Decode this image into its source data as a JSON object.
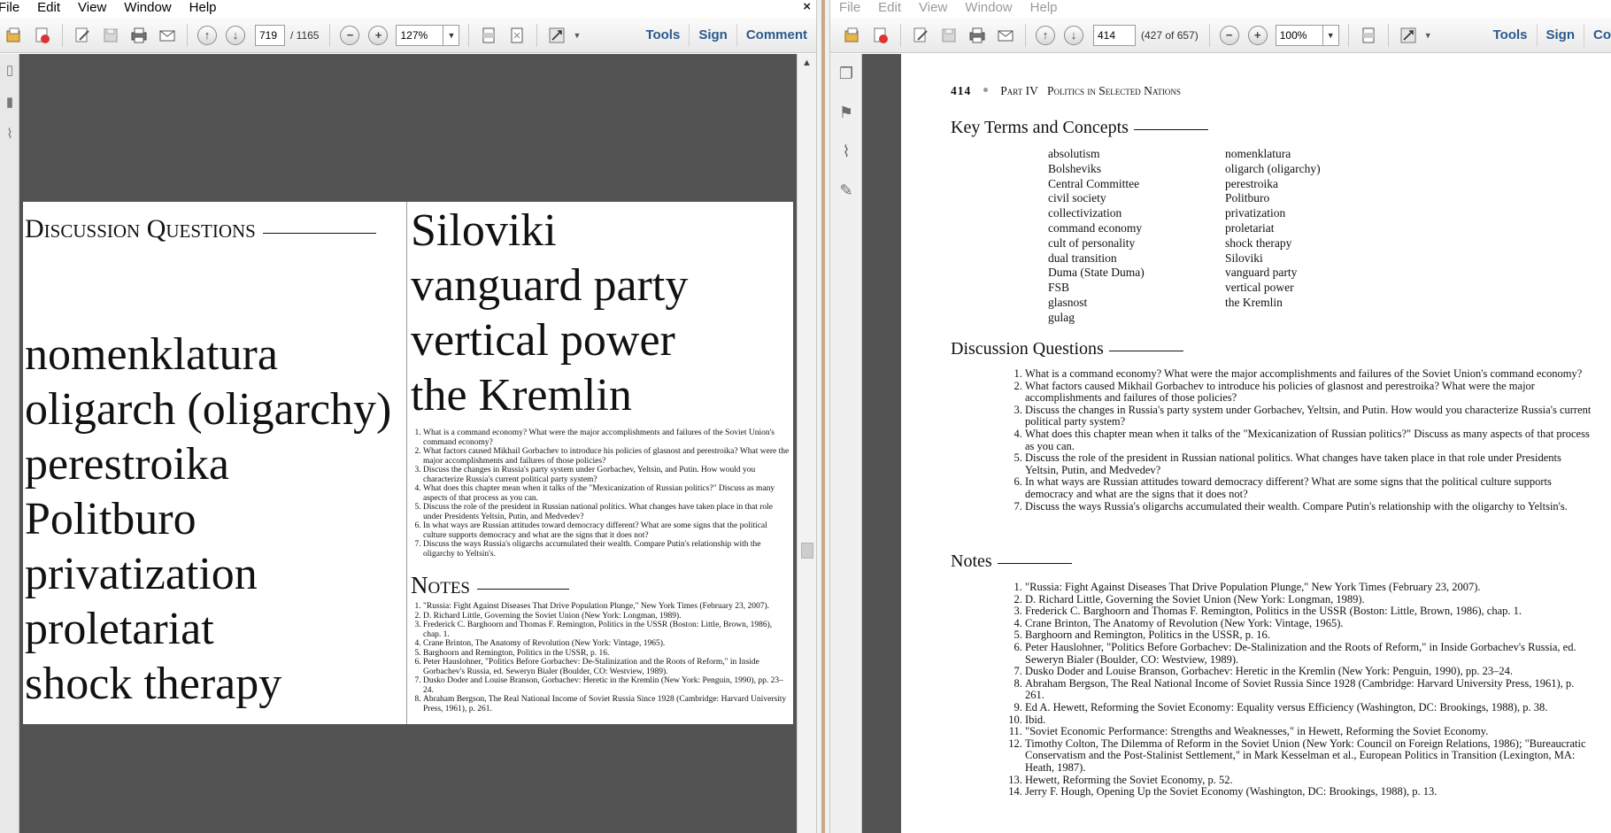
{
  "left": {
    "menu": [
      "File",
      "Edit",
      "View",
      "Window",
      "Help"
    ],
    "close_glyph": "×",
    "page_current": "719",
    "page_total": "/ 1165",
    "zoom": "127%",
    "tools": "Tools",
    "sign": "Sign",
    "comment": "Comment",
    "zoomed_page": {
      "heading": "Discussion Questions",
      "terms_left": [
        "nomenklatura",
        "oligarch (oligarchy)",
        "perestroika",
        "Politburo",
        "privatization",
        "proletariat",
        "shock therapy"
      ],
      "terms_right": [
        "Siloviki",
        "vanguard party",
        "vertical power",
        "the Kremlin"
      ],
      "notes_heading": "Notes"
    }
  },
  "right": {
    "menu": [
      "File",
      "Edit",
      "View",
      "Window",
      "Help"
    ],
    "page_current": "414",
    "page_of": "(427 of 657)",
    "zoom": "100%",
    "tools": "Tools",
    "sign": "Sign",
    "comment": "Co",
    "page": {
      "page_number": "414",
      "part": "Part IV",
      "part_title": "Politics in Selected Nations",
      "key_terms_heading": "Key Terms and Concepts",
      "terms_col1": [
        "absolutism",
        "Bolsheviks",
        "Central Committee",
        "civil society",
        "collectivization",
        "command economy",
        "cult of personality",
        "dual transition",
        "Duma (State Duma)",
        "FSB",
        "glasnost",
        "gulag"
      ],
      "terms_col2": [
        "nomenklatura",
        "oligarch (oligarchy)",
        "perestroika",
        "Politburo",
        "privatization",
        "proletariat",
        "shock therapy",
        "Siloviki",
        "vanguard party",
        "vertical power",
        "the Kremlin"
      ],
      "questions_heading": "Discussion Questions",
      "questions": [
        "What is a command economy? What were the major accomplishments and failures of the Soviet Union's command economy?",
        "What factors caused Mikhail Gorbachev to introduce his policies of glasnost and perestroika? What were the major accomplishments and failures of those policies?",
        "Discuss the changes in Russia's party system under Gorbachev, Yeltsin, and Putin. How would you characterize Russia's current political party system?",
        "What does this chapter mean when it talks of the \"Mexicanization of Russian politics?\" Discuss as many aspects of that process as you can.",
        "Discuss the role of the president in Russian national politics. What changes have taken place in that role under Presidents Yeltsin, Putin, and Medvedev?",
        "In what ways are Russian attitudes toward democracy different? What are some signs that the political culture supports democracy and what are the signs that it does not?",
        "Discuss the ways Russia's oligarchs accumulated their wealth. Compare Putin's relationship with the oligarchy to Yeltsin's."
      ],
      "notes_heading": "Notes",
      "notes": [
        "\"Russia: Fight Against Diseases That Drive Population Plunge,\" New York Times (February 23, 2007).",
        "D. Richard Little, Governing the Soviet Union (New York: Longman, 1989).",
        "Frederick C. Barghoorn and Thomas F. Remington, Politics in the USSR (Boston: Little, Brown, 1986), chap. 1.",
        "Crane Brinton, The Anatomy of Revolution (New York: Vintage, 1965).",
        "Barghoorn and Remington, Politics in the USSR, p. 16.",
        "Peter Hauslohner, \"Politics Before Gorbachev: De-Stalinization and the Roots of Reform,\" in Inside Gorbachev's Russia, ed. Seweryn Bialer (Boulder, CO: Westview, 1989).",
        "Dusko Doder and Louise Branson, Gorbachev: Heretic in the Kremlin (New York: Penguin, 1990), pp. 23–24.",
        "Abraham Bergson, The Real National Income of Soviet Russia Since 1928 (Cambridge: Harvard University Press, 1961), p. 261.",
        "Ed A. Hewett, Reforming the Soviet Economy: Equality versus Efficiency (Washington, DC: Brookings, 1988), p. 38.",
        "Ibid.",
        "\"Soviet Economic Performance: Strengths and Weaknesses,\" in Hewett, Reforming the Soviet Economy.",
        "Timothy Colton, The Dilemma of Reform in the Soviet Union (New York: Council on Foreign Relations, 1986); \"Bureaucratic Conservatism and the Post-Stalinist Settlement,\" in Mark Kesselman et al., European Politics in Transition (Lexington, MA: Heath, 1987).",
        "Hewett, Reforming the Soviet Economy, p. 52.",
        "Jerry F. Hough, Opening Up the Soviet Economy (Washington, DC: Brookings, 1988), p. 13."
      ]
    }
  }
}
